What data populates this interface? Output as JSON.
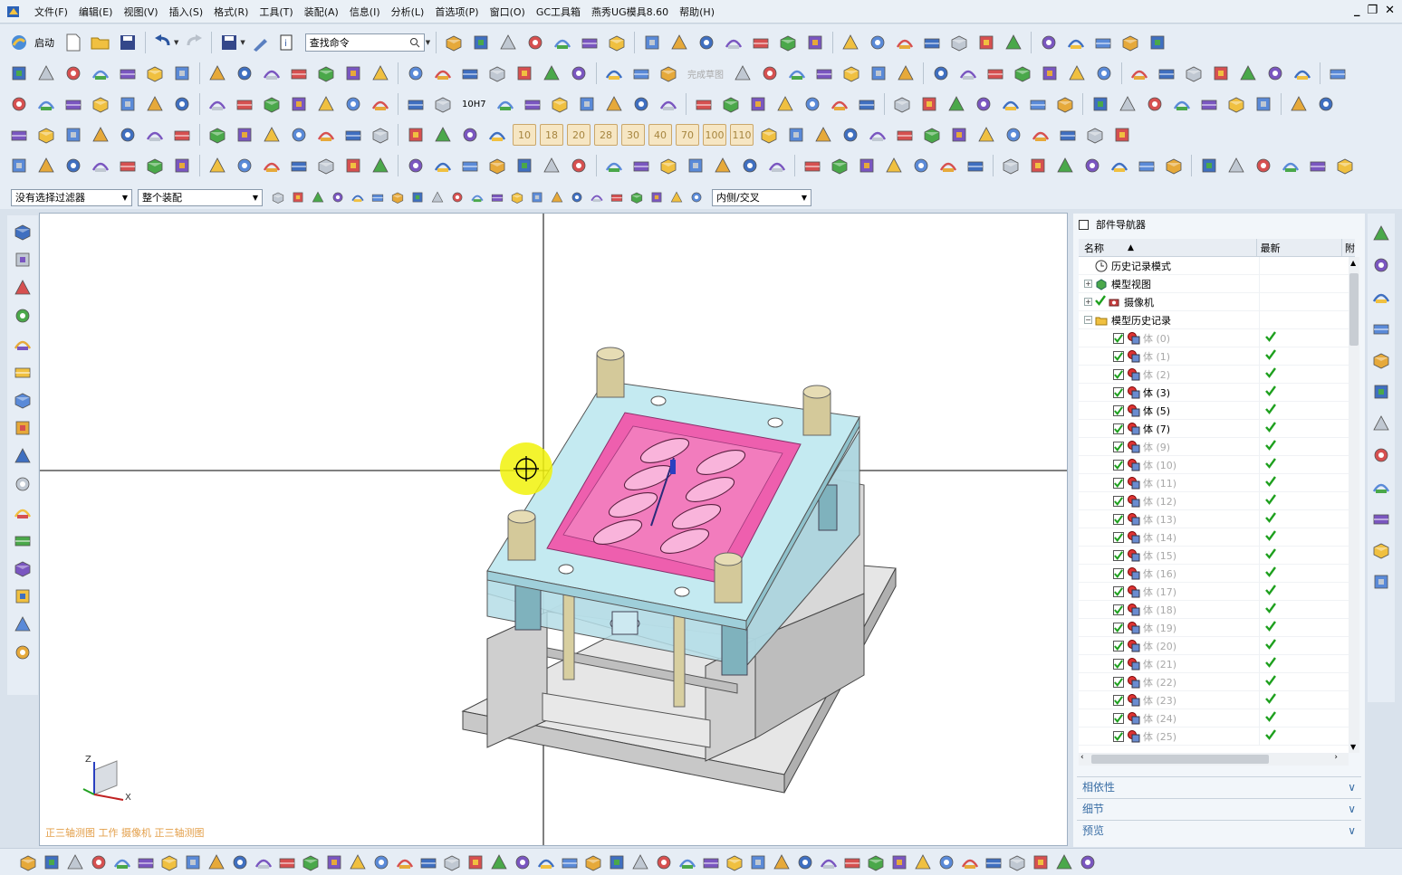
{
  "menu": {
    "items": [
      "文件(F)",
      "编辑(E)",
      "视图(V)",
      "插入(S)",
      "格式(R)",
      "工具(T)",
      "装配(A)",
      "信息(I)",
      "分析(L)",
      "首选项(P)",
      "窗口(O)",
      "GC工具箱",
      "燕秀UG模具8.60",
      "帮助(H)"
    ]
  },
  "window_controls": [
    "_",
    "❐",
    "✕"
  ],
  "toolbar": {
    "start_label": "启动",
    "search_placeholder": "查找命令",
    "number_buttons": [
      "10",
      "18",
      "20",
      "28",
      "30",
      "40",
      "70",
      "100",
      "110"
    ],
    "tol_label": "10H7",
    "grey_label": "完成草图"
  },
  "filter": {
    "selection_filter": "没有选择过滤器",
    "assembly_scope": "整个装配",
    "intersect_mode": "内侧/交叉"
  },
  "viewport": {
    "status": "正三轴测图 工作 摄像机 正三轴测图",
    "triad": {
      "z": "Z",
      "x": "X"
    }
  },
  "navigator": {
    "title": "部件导航器",
    "col_name": "名称",
    "col_latest": "最新",
    "col_extra": "附",
    "top_items": [
      {
        "label": "历史记录模式"
      },
      {
        "label": "模型视图"
      },
      {
        "label": "摄像机"
      },
      {
        "label": "模型历史记录"
      }
    ],
    "bodies": [
      {
        "label": "体 (0)",
        "dim": true
      },
      {
        "label": "体 (1)",
        "dim": true
      },
      {
        "label": "体 (2)",
        "dim": true
      },
      {
        "label": "体 (3)",
        "dim": false
      },
      {
        "label": "体 (5)",
        "dim": false
      },
      {
        "label": "体 (7)",
        "dim": false
      },
      {
        "label": "体 (9)",
        "dim": true
      },
      {
        "label": "体 (10)",
        "dim": true
      },
      {
        "label": "体 (11)",
        "dim": true
      },
      {
        "label": "体 (12)",
        "dim": true
      },
      {
        "label": "体 (13)",
        "dim": true
      },
      {
        "label": "体 (14)",
        "dim": true
      },
      {
        "label": "体 (15)",
        "dim": true
      },
      {
        "label": "体 (16)",
        "dim": true
      },
      {
        "label": "体 (17)",
        "dim": true
      },
      {
        "label": "体 (18)",
        "dim": true
      },
      {
        "label": "体 (19)",
        "dim": true
      },
      {
        "label": "体 (20)",
        "dim": true
      },
      {
        "label": "体 (21)",
        "dim": true
      },
      {
        "label": "体 (22)",
        "dim": true
      },
      {
        "label": "体 (23)",
        "dim": true
      },
      {
        "label": "体 (24)",
        "dim": true
      },
      {
        "label": "体 (25)",
        "dim": true
      }
    ],
    "panels": [
      "相依性",
      "细节",
      "预览"
    ]
  },
  "colors": {
    "accent": "#3a6ea5",
    "cavity_pink": "#ee5fae",
    "plate_cyan": "#bfe6ee",
    "check_green": "#1ea01e",
    "status_orange": "#e39f4a"
  }
}
